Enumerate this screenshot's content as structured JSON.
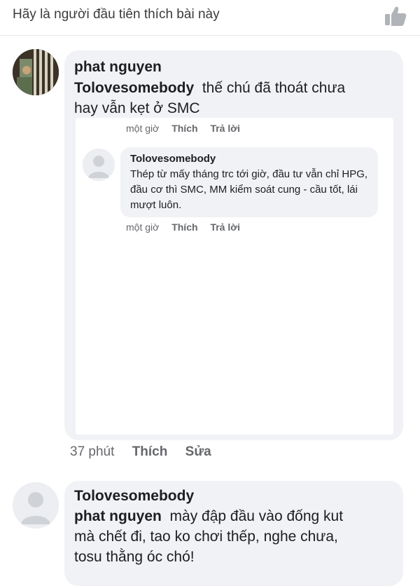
{
  "like_bar": {
    "text": "Hãy là người đầu tiên thích bài này",
    "icon": "thumbs-up-icon"
  },
  "comment1": {
    "author": "phat nguyen",
    "mention": "Tolovesomebody",
    "text_line1": "thế chú đã thoát chưa",
    "text_line2": "hay vẫn kẹt ở SMC",
    "time": "một giờ",
    "like": "Thích",
    "reply": "Trả lời",
    "reply_item": {
      "author": "Tolovesomebody",
      "text": "Thép từ mấy tháng trc tới giờ, đầu tư vẫn chỉ HPG, đầu cơ thì SMC, MM kiểm soát cung - cầu tốt, lái mượt luôn.",
      "time": "một giờ",
      "like": "Thích",
      "reply": "Trả lời"
    },
    "outer_time": "37 phút",
    "outer_like": "Thích",
    "outer_edit": "Sửa"
  },
  "comment2": {
    "author": "Tolovesomebody",
    "mention": "phat nguyen",
    "text_line1": "mày đập đầu vào đống kut",
    "text_line2": "mà chết đi, tao ko chơi thếp, nghe chưa,",
    "text_line3": "tosu thằng óc chó!"
  }
}
